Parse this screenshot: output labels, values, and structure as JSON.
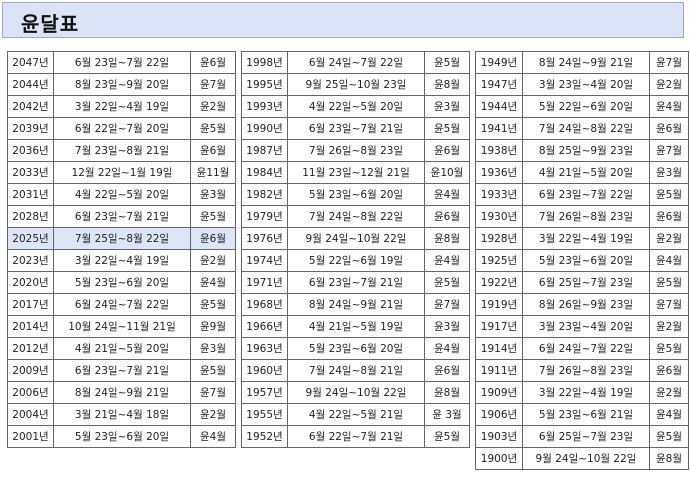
{
  "title": "윤달표",
  "columns": [
    {
      "rows": [
        {
          "year": "2047년",
          "dates": "6월 23일~7월 22일",
          "leap": "윤6월"
        },
        {
          "year": "2044년",
          "dates": "8월 23일~9월 20일",
          "leap": "윤7월"
        },
        {
          "year": "2042년",
          "dates": "3월 22일~4월 19일",
          "leap": "윤2월"
        },
        {
          "year": "2039년",
          "dates": "6월 22일~7월 20일",
          "leap": "윤5월"
        },
        {
          "year": "2036년",
          "dates": "7월 23일~8월 21일",
          "leap": "윤6월"
        },
        {
          "year": "2033년",
          "dates": "12월 22일~1월 19일",
          "leap": "윤11월"
        },
        {
          "year": "2031년",
          "dates": "4월 22일~5월 20일",
          "leap": "윤3월"
        },
        {
          "year": "2028년",
          "dates": "6월 23일~7월 21일",
          "leap": "윤5월"
        },
        {
          "year": "2025년",
          "dates": "7월 25일~8월 22일",
          "leap": "윤6월",
          "highlight": true
        },
        {
          "year": "2023년",
          "dates": "3월 22일~4월 19일",
          "leap": "윤2월"
        },
        {
          "year": "2020년",
          "dates": "5월 23일~6월 20일",
          "leap": "윤4월"
        },
        {
          "year": "2017년",
          "dates": "6월 24일~7월 22일",
          "leap": "윤5월"
        },
        {
          "year": "2014년",
          "dates": "10월 24일~11월 21일",
          "leap": "윤9월"
        },
        {
          "year": "2012년",
          "dates": "4월 21일~5월 20일",
          "leap": "윤3월"
        },
        {
          "year": "2009년",
          "dates": "6월 23일~7월 21일",
          "leap": "윤5월"
        },
        {
          "year": "2006년",
          "dates": "8월 24일~9월 21일",
          "leap": "윤7월"
        },
        {
          "year": "2004년",
          "dates": "3월 21일~4월 18일",
          "leap": "윤2월"
        },
        {
          "year": "2001년",
          "dates": "5월 23일~6월 20일",
          "leap": "윤4월"
        }
      ]
    },
    {
      "rows": [
        {
          "year": "1998년",
          "dates": "6월 24일~7월 22일",
          "leap": "윤5월"
        },
        {
          "year": "1995년",
          "dates": "9월 25일~10월 23일",
          "leap": "윤8월"
        },
        {
          "year": "1993년",
          "dates": "4월 22일~5월 20일",
          "leap": "윤3월"
        },
        {
          "year": "1990년",
          "dates": "6월 23일~7월 21일",
          "leap": "윤5월"
        },
        {
          "year": "1987년",
          "dates": "7월 26일~8월 23일",
          "leap": "윤6월"
        },
        {
          "year": "1984년",
          "dates": "11월 23일~12월 21일",
          "leap": "윤10월"
        },
        {
          "year": "1982년",
          "dates": "5월 23일~6월 20일",
          "leap": "윤4월"
        },
        {
          "year": "1979년",
          "dates": "7월 24일~8월 22일",
          "leap": "윤6월"
        },
        {
          "year": "1976년",
          "dates": "9월 24일~10월 22일",
          "leap": "윤8월"
        },
        {
          "year": "1974년",
          "dates": "5월 22일~6월 19일",
          "leap": "윤4월"
        },
        {
          "year": "1971년",
          "dates": "6월 23일~7월 21일",
          "leap": "윤5월"
        },
        {
          "year": "1968년",
          "dates": "8월 24일~9월 21일",
          "leap": "윤7월"
        },
        {
          "year": "1966년",
          "dates": "4월 21일~5월 19일",
          "leap": "윤3월"
        },
        {
          "year": "1963년",
          "dates": "5월 23일~6월 20일",
          "leap": "윤4월"
        },
        {
          "year": "1960년",
          "dates": "7월 24일~8월 21일",
          "leap": "윤6월"
        },
        {
          "year": "1957년",
          "dates": "9월 24일~10월 22일",
          "leap": "윤8월"
        },
        {
          "year": "1955년",
          "dates": "4월 22일~5월 21일",
          "leap": "윤 3월"
        },
        {
          "year": "1952년",
          "dates": "6월 22일~7월 21일",
          "leap": "윤5월"
        }
      ]
    },
    {
      "rows": [
        {
          "year": "1949년",
          "dates": "8월 24일~9월 21일",
          "leap": "윤7월"
        },
        {
          "year": "1947년",
          "dates": "3월 23일~4월 20일",
          "leap": "윤2월"
        },
        {
          "year": "1944년",
          "dates": "5월 22일~6월 20일",
          "leap": "윤4월"
        },
        {
          "year": "1941년",
          "dates": "7월 24일~8월 22일",
          "leap": "윤6월"
        },
        {
          "year": "1938년",
          "dates": "8월 25일~9월 23일",
          "leap": "윤7월"
        },
        {
          "year": "1936년",
          "dates": "4월 21일~5월 20일",
          "leap": "윤3월"
        },
        {
          "year": "1933년",
          "dates": "6월 23일~7월 22일",
          "leap": "윤5월"
        },
        {
          "year": "1930년",
          "dates": "7월 26일~8월 23일",
          "leap": "윤6월"
        },
        {
          "year": "1928년",
          "dates": "3월 22일~4월 19일",
          "leap": "윤2월"
        },
        {
          "year": "1925년",
          "dates": "5월 23일~6월 20일",
          "leap": "윤4월"
        },
        {
          "year": "1922년",
          "dates": "6월 25일~7월 23일",
          "leap": "윤5월"
        },
        {
          "year": "1919년",
          "dates": "8월 26일~9월 23일",
          "leap": "윤7월"
        },
        {
          "year": "1917년",
          "dates": "3월 23일~4월 20일",
          "leap": "윤2월"
        },
        {
          "year": "1914년",
          "dates": "6월 24일~7월 22일",
          "leap": "윤5월"
        },
        {
          "year": "1911년",
          "dates": "7월 26일~8월 23일",
          "leap": "윤6월"
        },
        {
          "year": "1909년",
          "dates": "3월 22일~4월 19일",
          "leap": "윤2월"
        },
        {
          "year": "1906년",
          "dates": "5월 23일~6월 21일",
          "leap": "윤4월"
        },
        {
          "year": "1903년",
          "dates": "6월 25일~7월 23일",
          "leap": "윤5월"
        },
        {
          "year": "1900년",
          "dates": "9월 24일~10월 22일",
          "leap": "윤8월"
        }
      ]
    }
  ]
}
